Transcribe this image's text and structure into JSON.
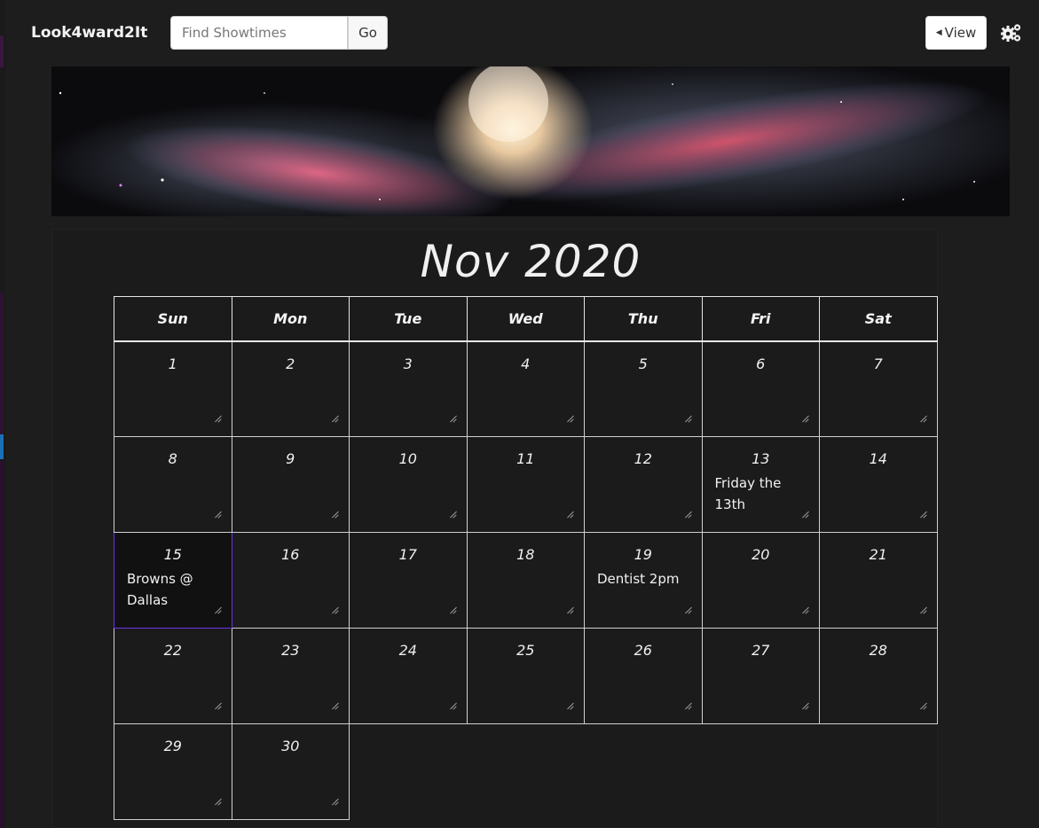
{
  "navbar": {
    "brand": "Look4ward2It",
    "search_placeholder": "Find Showtimes",
    "go_label": "Go",
    "view_label": "View"
  },
  "calendar": {
    "title": "Nov 2020",
    "weekdays": [
      "Sun",
      "Mon",
      "Tue",
      "Wed",
      "Thu",
      "Fri",
      "Sat"
    ],
    "weeks": [
      [
        {
          "day": "1",
          "note": ""
        },
        {
          "day": "2",
          "note": ""
        },
        {
          "day": "3",
          "note": ""
        },
        {
          "day": "4",
          "note": ""
        },
        {
          "day": "5",
          "note": ""
        },
        {
          "day": "6",
          "note": ""
        },
        {
          "day": "7",
          "note": ""
        }
      ],
      [
        {
          "day": "8",
          "note": ""
        },
        {
          "day": "9",
          "note": ""
        },
        {
          "day": "10",
          "note": ""
        },
        {
          "day": "11",
          "note": ""
        },
        {
          "day": "12",
          "note": ""
        },
        {
          "day": "13",
          "note": "Friday the 13th"
        },
        {
          "day": "14",
          "note": ""
        }
      ],
      [
        {
          "day": "15",
          "note": "Browns @ Dallas"
        },
        {
          "day": "16",
          "note": ""
        },
        {
          "day": "17",
          "note": ""
        },
        {
          "day": "18",
          "note": ""
        },
        {
          "day": "19",
          "note": "Dentist 2pm"
        },
        {
          "day": "20",
          "note": ""
        },
        {
          "day": "21",
          "note": ""
        }
      ],
      [
        {
          "day": "22",
          "note": ""
        },
        {
          "day": "23",
          "note": ""
        },
        {
          "day": "24",
          "note": ""
        },
        {
          "day": "25",
          "note": ""
        },
        {
          "day": "26",
          "note": ""
        },
        {
          "day": "27",
          "note": ""
        },
        {
          "day": "28",
          "note": ""
        }
      ],
      [
        {
          "day": "29",
          "note": ""
        },
        {
          "day": "30",
          "note": ""
        }
      ]
    ],
    "today": "15"
  },
  "colors": {
    "background": "#1d1d1d",
    "today_glow": "#7a1fd1"
  }
}
